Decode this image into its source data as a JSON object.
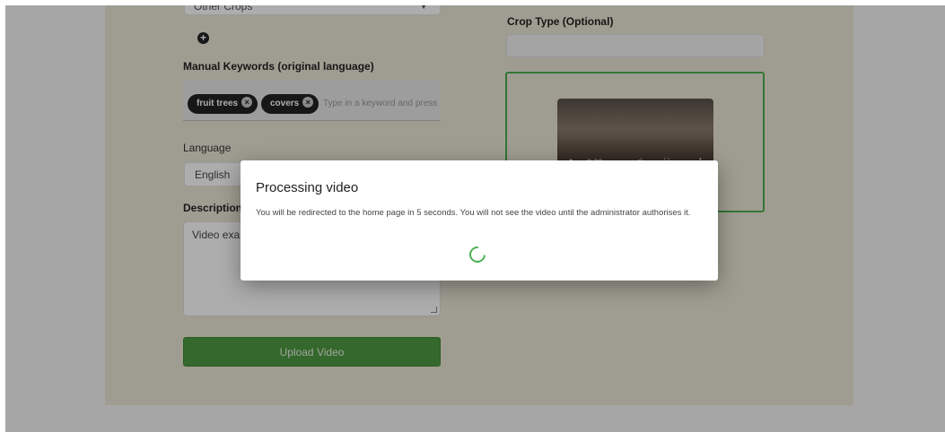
{
  "form": {
    "crop_select_value": "Other Crops",
    "add_label": "+",
    "manual_keywords_label": "Manual Keywords (original language)",
    "keywords": [
      {
        "text": "fruit trees"
      },
      {
        "text": "covers"
      }
    ],
    "keyword_placeholder": "Type in a keyword and press t",
    "language_label": "Language",
    "language_value": "English",
    "description_label": "Description",
    "description_value": "Video exam",
    "upload_button": "Upload Video",
    "crop_type_label": "Crop Type (Optional)",
    "video": {
      "time": "0:00",
      "play_icon": "play-icon",
      "volume_icon": "volume-icon",
      "fullscreen_icon": "fullscreen-icon",
      "more_icon": "more-vertical-icon"
    }
  },
  "dialog": {
    "title": "Processing video",
    "message": "You will be redirected to the home page in 5 seconds. You will not see the video until the administrator authorises it."
  },
  "colors": {
    "accent": "#4caf50",
    "button": "#4e9a41",
    "card": "#ebe8d6",
    "chip": "#222222"
  }
}
